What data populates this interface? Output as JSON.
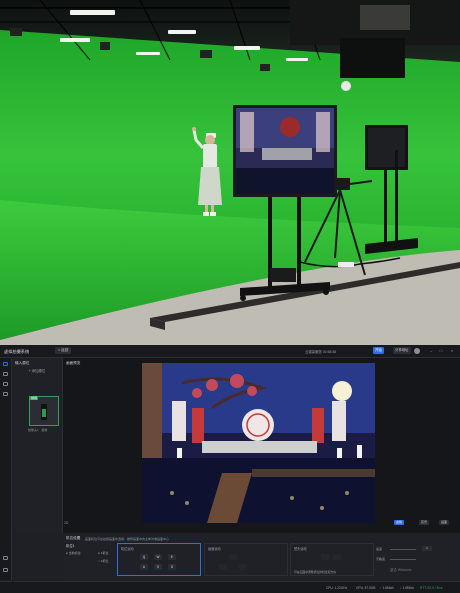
{
  "app": {
    "title": "虚拟拍摄系统",
    "back_label": "< 返回",
    "status_text": "云渲染服务 00:58:58",
    "start_label": "开始",
    "share_label": "分享地址",
    "minimize_icon": "minimize-icon",
    "maximize_icon": "maximize-icon",
    "close_icon": "close-icon"
  },
  "sources": {
    "header": "输入源位",
    "add_label": "+ 添加源位",
    "thumb_tag": "绿幕",
    "thumb_caption": "摄像头1 · 抠像"
  },
  "center": {
    "header": "画面预览",
    "canvas_label": "2D",
    "buttons": [
      "虚拟",
      "实景",
      "画面"
    ]
  },
  "bottom": {
    "header": "机位设置",
    "notice": "画面机位可在拍摄画面中选择，推荐画面中的主体对准画面中心",
    "tab_label": "机位1",
    "radio_1": "● 当前机位",
    "radio_a": "● 1机位",
    "radio_b": "○ 2机位",
    "panel_1_title": "机位运动",
    "panel_2_title": "画面运动",
    "panel_3_title": "镜头运动",
    "panel_3_note": "可在画面中调整机位的机位和方向",
    "keys": [
      "Q",
      "W",
      "E",
      "A",
      "S",
      "D"
    ],
    "slider_labels": [
      "速度",
      "灵敏度"
    ],
    "slider_value": "1"
  },
  "watermark": "激活 Windows",
  "statusbar": {
    "cpu": "CPU: 1.23GHz",
    "gpu": "GPU: 57.5GB",
    "upload": "↑ 1.6Mb/s",
    "download": "↓ 1.6Mb/s",
    "rtt": "RTT: 82.0 / 3ms"
  },
  "colors": {
    "accent": "#2f6fe0",
    "green_screen": "#2fbf3a",
    "badge_green": "#2aa35a"
  }
}
